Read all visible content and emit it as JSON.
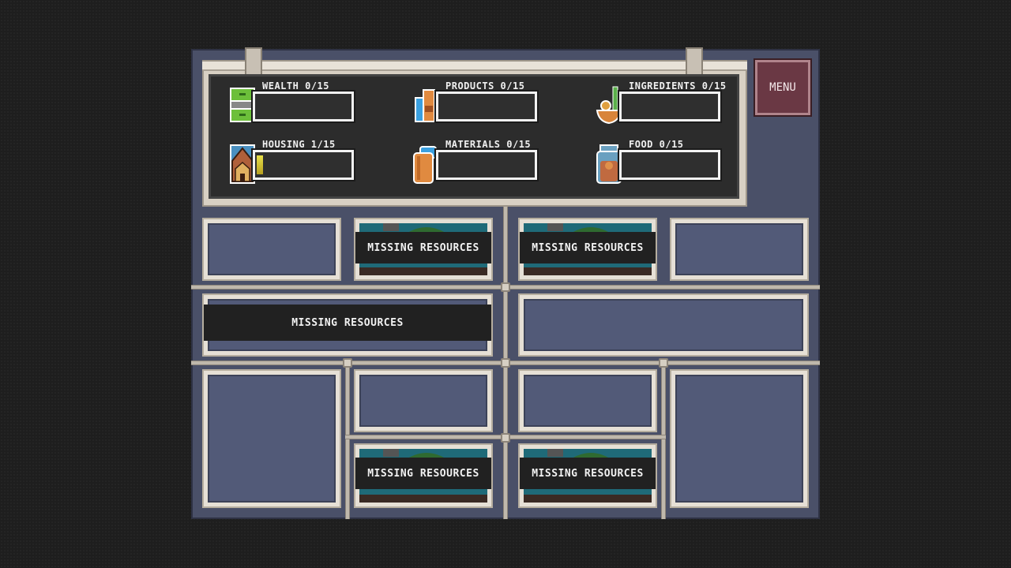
{
  "hud": {
    "resources": [
      {
        "id": "wealth",
        "label": "WEALTH 0/15",
        "value": 0,
        "max": 15,
        "icon": "cash-icon"
      },
      {
        "id": "products",
        "label": "PRODUCTS 0/15",
        "value": 0,
        "max": 15,
        "icon": "product-icon"
      },
      {
        "id": "ingredients",
        "label": "INGREDIENTS 0/15",
        "value": 0,
        "max": 15,
        "icon": "ingredients-icon"
      },
      {
        "id": "housing",
        "label": "HOUSING 1/15",
        "value": 1,
        "max": 15,
        "icon": "house-icon"
      },
      {
        "id": "materials",
        "label": "MATERIALS 0/15",
        "value": 0,
        "max": 15,
        "icon": "materials-icon"
      },
      {
        "id": "food",
        "label": "FOOD 0/15",
        "value": 0,
        "max": 15,
        "icon": "food-jar-icon"
      }
    ]
  },
  "menu": {
    "label": "MENU"
  },
  "slots": {
    "missing_label": "MISSING RESOURCES"
  },
  "colors": {
    "board": "#4a5068",
    "menu": "#6a3844",
    "bar_fill": "#e8e04a"
  }
}
